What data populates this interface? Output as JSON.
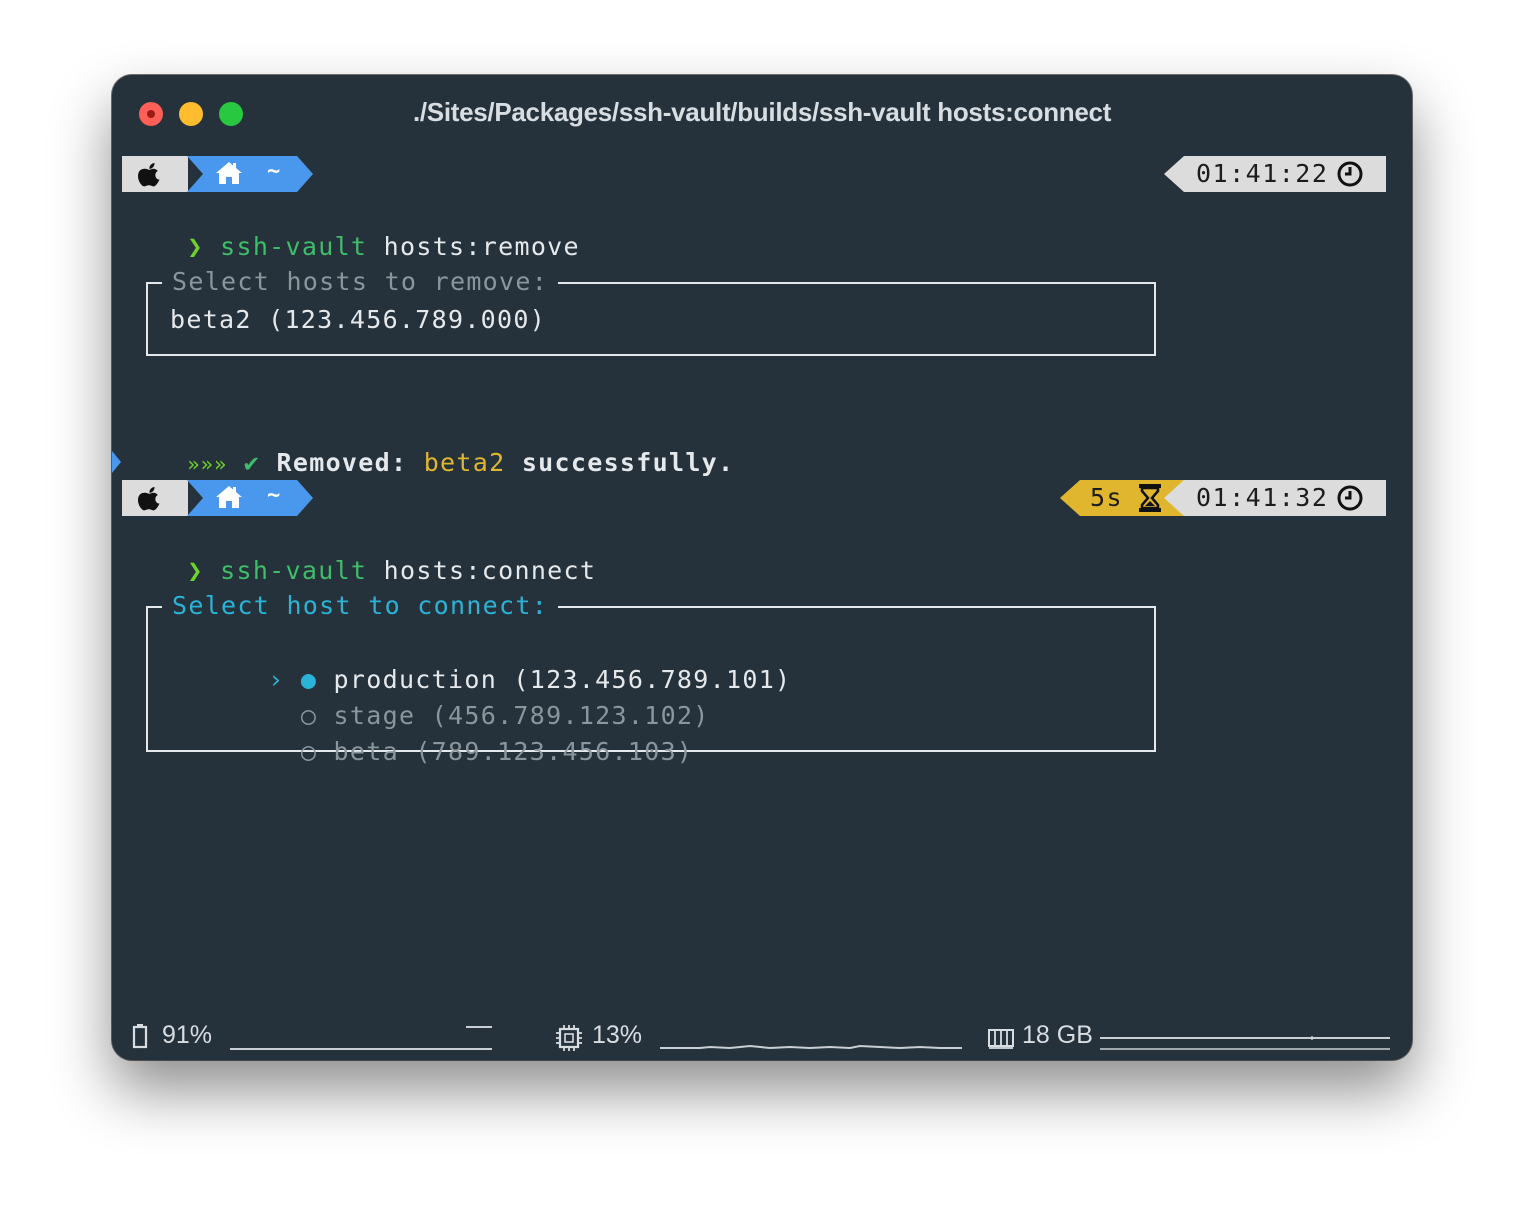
{
  "window": {
    "title": "./Sites/Packages/ssh-vault/builds/ssh-vault hosts:connect"
  },
  "prompt1": {
    "home_symbol": "~",
    "time": "01:41:22",
    "char": "❯",
    "cmd_name": "ssh-vault",
    "cmd_args": "hosts:remove"
  },
  "remove_box": {
    "label": "Select hosts to remove:",
    "selection": "beta2 (123.456.789.000)"
  },
  "result": {
    "arrows": "»»»",
    "check": "✔",
    "label": "Removed:",
    "host": "beta2",
    "suffix": "successfully."
  },
  "prompt2": {
    "home_symbol": "~",
    "duration": "5s",
    "time": "01:41:32",
    "char": "❯",
    "cmd_name": "ssh-vault",
    "cmd_args": "hosts:connect"
  },
  "connect_box": {
    "label": "Select host to connect:",
    "pointer": "›",
    "options": [
      {
        "bullet": "●",
        "name": "production",
        "ip": "(123.456.789.101)",
        "selected": true
      },
      {
        "bullet": "○",
        "name": "stage",
        "ip": "(456.789.123.102)",
        "selected": false
      },
      {
        "bullet": "○",
        "name": "beta",
        "ip": "(789.123.456.103)",
        "selected": false
      }
    ]
  },
  "status_bar": {
    "battery": "91%",
    "cpu": "13%",
    "memory": "18 GB"
  },
  "icons": [
    "apple-icon",
    "home-icon",
    "clock-icon",
    "hourglass-icon",
    "battery-icon",
    "cpu-icon",
    "memory-icon"
  ],
  "colors": {
    "background": "#26323b",
    "segment_gray": "#dcdcdc",
    "segment_blue": "#4a97ee",
    "segment_yellow": "#e0b62e",
    "prompt_green": "#6ed32a",
    "command_green": "#3fbd69",
    "cyan": "#2bb3d7",
    "dim": "#8b959c"
  }
}
